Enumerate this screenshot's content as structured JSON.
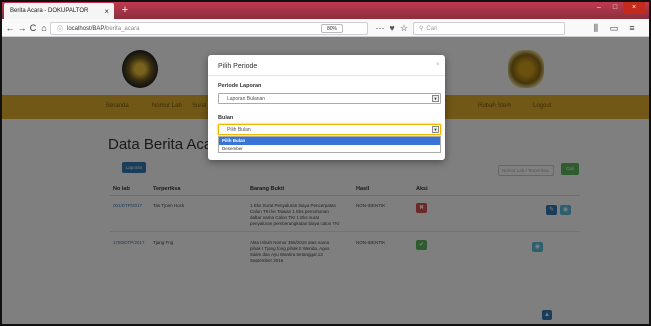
{
  "browser": {
    "tab_title": "Berita Acara - DOKUPALTOR",
    "tab_close": "×",
    "new_tab": "+",
    "back": "←",
    "forward": "→",
    "reload": "C",
    "home": "⌂",
    "url_host": "localhost/BAP/",
    "url_path": "berita_acara",
    "zoom": "80%",
    "more": "···",
    "search_placeholder": "Cari",
    "win_min": "–",
    "win_max": "□",
    "win_close": "×"
  },
  "menu": {
    "items": [
      "Beranda",
      "Nomor Lab",
      "Surat",
      "Rubah Stem",
      "Logout"
    ]
  },
  "page": {
    "title": "Data Berita Acara F",
    "laporan_button": "Laporan",
    "search_placeholder": "Nomor Lab / Terperiksa",
    "cari_button": "Cari"
  },
  "table": {
    "headers": [
      "No lab",
      "Terperiksa",
      "Barang Bukti",
      "Hasil",
      "Aksi"
    ],
    "rows": [
      {
        "nolab": "001/DTP/2017",
        "terperiksa": "Tan Tjoen Hock",
        "bukti": [
          "1 Eks Surat Penyaluran biaya Pencerpatan",
          "Calon TKI ke Taiwan 1 Eks pernohonan",
          "daftar nama Calon TKI 1 Eks surat",
          "penyaluran pemberangkatan biaya calon TKI"
        ],
        "hasil": "NON-IDENTIK",
        "status_icon": "✖"
      },
      {
        "nolab": "1780/DTP/2017",
        "terperiksa": "Tjang Fng",
        "bukti": [
          "Akta Hibah Nomor 355/2016 atas nama",
          "pihak I Tjang fong pihak II Wenda, Agus",
          "Salim dan Ayu Wantira tertanggal 13",
          "September 2016"
        ],
        "hasil": "NON-IDENTIK",
        "status_icon": "✔"
      }
    ]
  },
  "modal": {
    "title": "Pilih Periode",
    "close": "×",
    "label_laporan": "Periode Laporan",
    "laporan_value": "Laporan Bulanan",
    "label_bulan": "Bulan",
    "bulan_value": "Pilih Bulan",
    "options": [
      "Pilih Bulan",
      "Desember"
    ],
    "arrow": "▼"
  },
  "colors": {
    "menu_bar": "#e2b12c",
    "tab_bar": "#c73a52",
    "primary": "#337ab7",
    "success": "#5cb85c",
    "danger": "#d9534f"
  }
}
